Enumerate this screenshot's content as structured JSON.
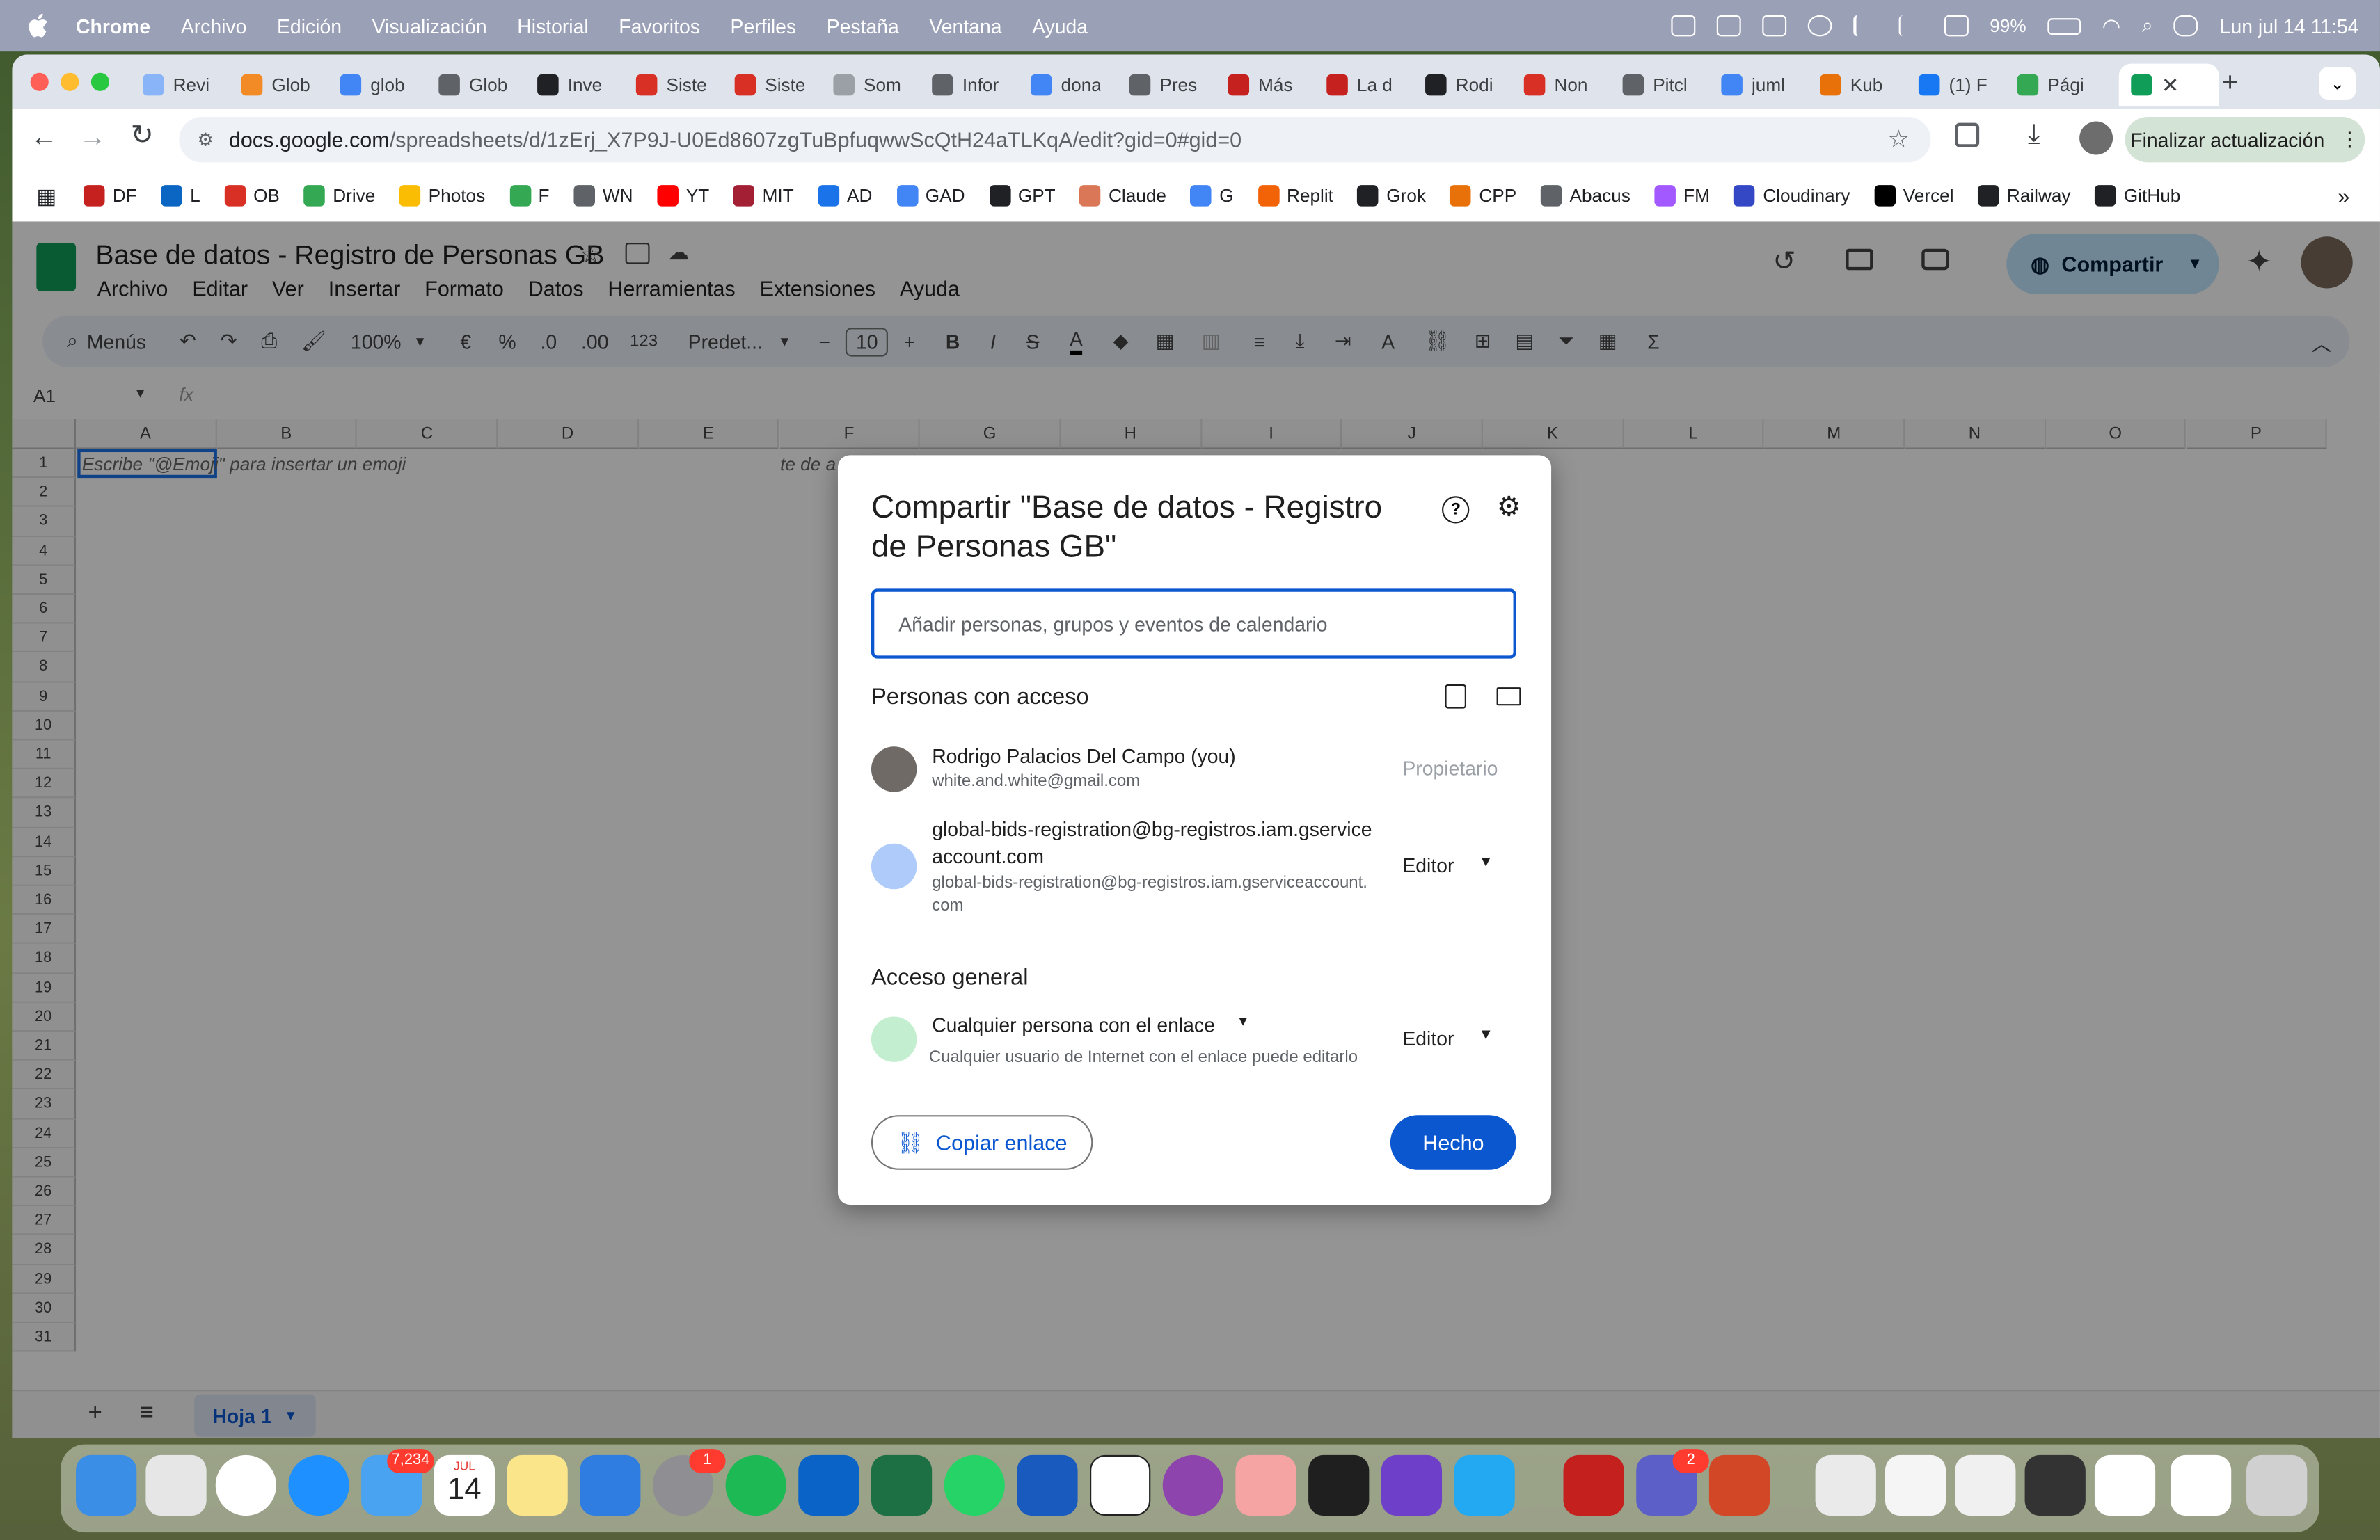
{
  "menubar": {
    "app": "Chrome",
    "items": [
      "Archivo",
      "Edición",
      "Visualización",
      "Historial",
      "Favoritos",
      "Perfiles",
      "Pestaña",
      "Ventana",
      "Ayuda"
    ],
    "battery": "99%",
    "datetime": "Lun jul 14  11:54"
  },
  "tabs": [
    {
      "label": "Revi",
      "color": "#8ab4f8"
    },
    {
      "label": "Glob",
      "color": "#f28b25"
    },
    {
      "label": "glob",
      "color": "#4285f4"
    },
    {
      "label": "Glob",
      "color": "#5f6368"
    },
    {
      "label": "Inve",
      "color": "#202124"
    },
    {
      "label": "Siste",
      "color": "#d93025"
    },
    {
      "label": "Siste",
      "color": "#d93025"
    },
    {
      "label": "Som",
      "color": "#9aa0a6"
    },
    {
      "label": "Infor",
      "color": "#5f6368"
    },
    {
      "label": "dona",
      "color": "#4285f4"
    },
    {
      "label": "Pres",
      "color": "#5f6368"
    },
    {
      "label": "Más",
      "color": "#c5221f"
    },
    {
      "label": "La d",
      "color": "#c5221f"
    },
    {
      "label": "Rodi",
      "color": "#202124"
    },
    {
      "label": "Non",
      "color": "#d93025"
    },
    {
      "label": "Pitcl",
      "color": "#5f6368"
    },
    {
      "label": "juml",
      "color": "#4285f4"
    },
    {
      "label": "Kub",
      "color": "#e8710a"
    },
    {
      "label": "(1) F",
      "color": "#1877f2"
    },
    {
      "label": "Pági",
      "color": "#34a853"
    }
  ],
  "url": {
    "host": "docs.google.com",
    "path": "/spreadsheets/d/1zErj_X7P9J-U0Ed8607zgTuBpfuqwwScQtH24aTLKqA/edit?gid=0#gid=0"
  },
  "update_button": "Finalizar actualización",
  "bookmarks": [
    {
      "label": "DF",
      "color": "#c5221f"
    },
    {
      "label": "L",
      "color": "#0a66c2"
    },
    {
      "label": "OB",
      "color": "#d93025"
    },
    {
      "label": "Drive",
      "color": "#34a853"
    },
    {
      "label": "Photos",
      "color": "#fbbc04"
    },
    {
      "label": "F",
      "color": "#34a853"
    },
    {
      "label": "WN",
      "color": "#5f6368"
    },
    {
      "label": "YT",
      "color": "#ff0000"
    },
    {
      "label": "MIT",
      "color": "#a31f34"
    },
    {
      "label": "AD",
      "color": "#1a73e8"
    },
    {
      "label": "GAD",
      "color": "#4285f4"
    },
    {
      "label": "GPT",
      "color": "#202124"
    },
    {
      "label": "Claude",
      "color": "#d97757"
    },
    {
      "label": "G",
      "color": "#4285f4"
    },
    {
      "label": "Replit",
      "color": "#f26207"
    },
    {
      "label": "Grok",
      "color": "#202124"
    },
    {
      "label": "CPP",
      "color": "#e8710a"
    },
    {
      "label": "Abacus",
      "color": "#5f6368"
    },
    {
      "label": "FM",
      "color": "#a259ff"
    },
    {
      "label": "Cloudinary",
      "color": "#3448c5"
    },
    {
      "label": "Vercel",
      "color": "#000000"
    },
    {
      "label": "Railway",
      "color": "#202124"
    },
    {
      "label": "GitHub",
      "color": "#202124"
    }
  ],
  "sheet": {
    "title": "Base de datos - Registro de Personas GB",
    "menu": [
      "Archivo",
      "Editar",
      "Ver",
      "Insertar",
      "Formato",
      "Datos",
      "Herramientas",
      "Extensiones",
      "Ayuda"
    ],
    "share_label": "Compartir",
    "search_menus": "Menús",
    "zoom": "100%",
    "currency": "€",
    "percent": "%",
    "dec_less": ".0",
    "dec_more": ".00",
    "num_format": "123",
    "font": "Predet...",
    "font_size": "10",
    "cell_ref": "A1",
    "fx": "fx",
    "columns": [
      "A",
      "B",
      "C",
      "D",
      "E",
      "F",
      "G",
      "H",
      "I",
      "J",
      "K",
      "L",
      "M",
      "N",
      "O",
      "P"
    ],
    "rows": [
      "1",
      "2",
      "3",
      "4",
      "5",
      "6",
      "7",
      "8",
      "9",
      "10",
      "11",
      "12",
      "13",
      "14",
      "15",
      "16",
      "17",
      "18",
      "19",
      "20",
      "21",
      "22",
      "23",
      "24",
      "25",
      "26",
      "27",
      "28",
      "29",
      "30",
      "31"
    ],
    "cell_hint": "Escribe \"@Emoji\" para insertar un emoji",
    "hidden_hint": "te de a",
    "sheet_tab": "Hoja 1"
  },
  "dialog": {
    "title": "Compartir \"Base de datos - Registro de Personas GB\"",
    "input_placeholder": "Añadir personas, grupos y eventos de calendario",
    "people_heading": "Personas con acceso",
    "people": [
      {
        "name": "Rodrigo Palacios Del Campo (you)",
        "email": "white.and.white@gmail.com",
        "role": "Propietario"
      },
      {
        "name": "global-bids-registration@bg-registros.iam.gserviceaccount.com",
        "email": "global-bids-registration@bg-registros.iam.gserviceaccount.com",
        "role": "Editor"
      }
    ],
    "general_heading": "Acceso general",
    "general_access": "Cualquier persona con el enlace",
    "general_desc": "Cualquier usuario de Internet con el enlace puede editarlo",
    "general_role": "Editor",
    "copy_link": "Copiar enlace",
    "done": "Hecho"
  },
  "dock": {
    "badges": {
      "mail": "7,234",
      "calendar_month": "JUL",
      "calendar_day": "14",
      "settings": "1",
      "teams": "2"
    }
  }
}
